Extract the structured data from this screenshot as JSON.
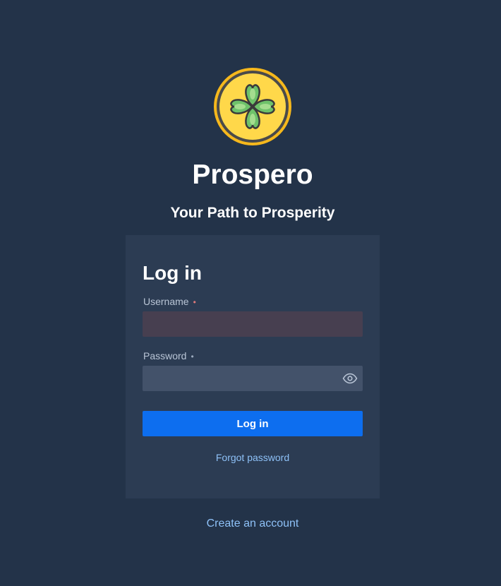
{
  "brand": {
    "logo_icon": "four-leaf-clover-icon",
    "name": "Prospero",
    "tagline": "Your Path to Prosperity"
  },
  "login_form": {
    "title": "Log in",
    "username": {
      "label": "Username",
      "required_marker": "•",
      "value": "",
      "placeholder": ""
    },
    "password": {
      "label": "Password",
      "required_marker": "•",
      "value": "",
      "placeholder": "",
      "toggle_icon": "eye-icon"
    },
    "submit_label": "Log in",
    "forgot_password_label": "Forgot password"
  },
  "create_account_label": "Create an account",
  "colors": {
    "background": "#233349",
    "card": "#2c3c53",
    "primary_button": "#0d6eef",
    "link": "#8ec1f7",
    "logo_gold": "#f6b81c",
    "clover_green": "#6ec26a"
  }
}
